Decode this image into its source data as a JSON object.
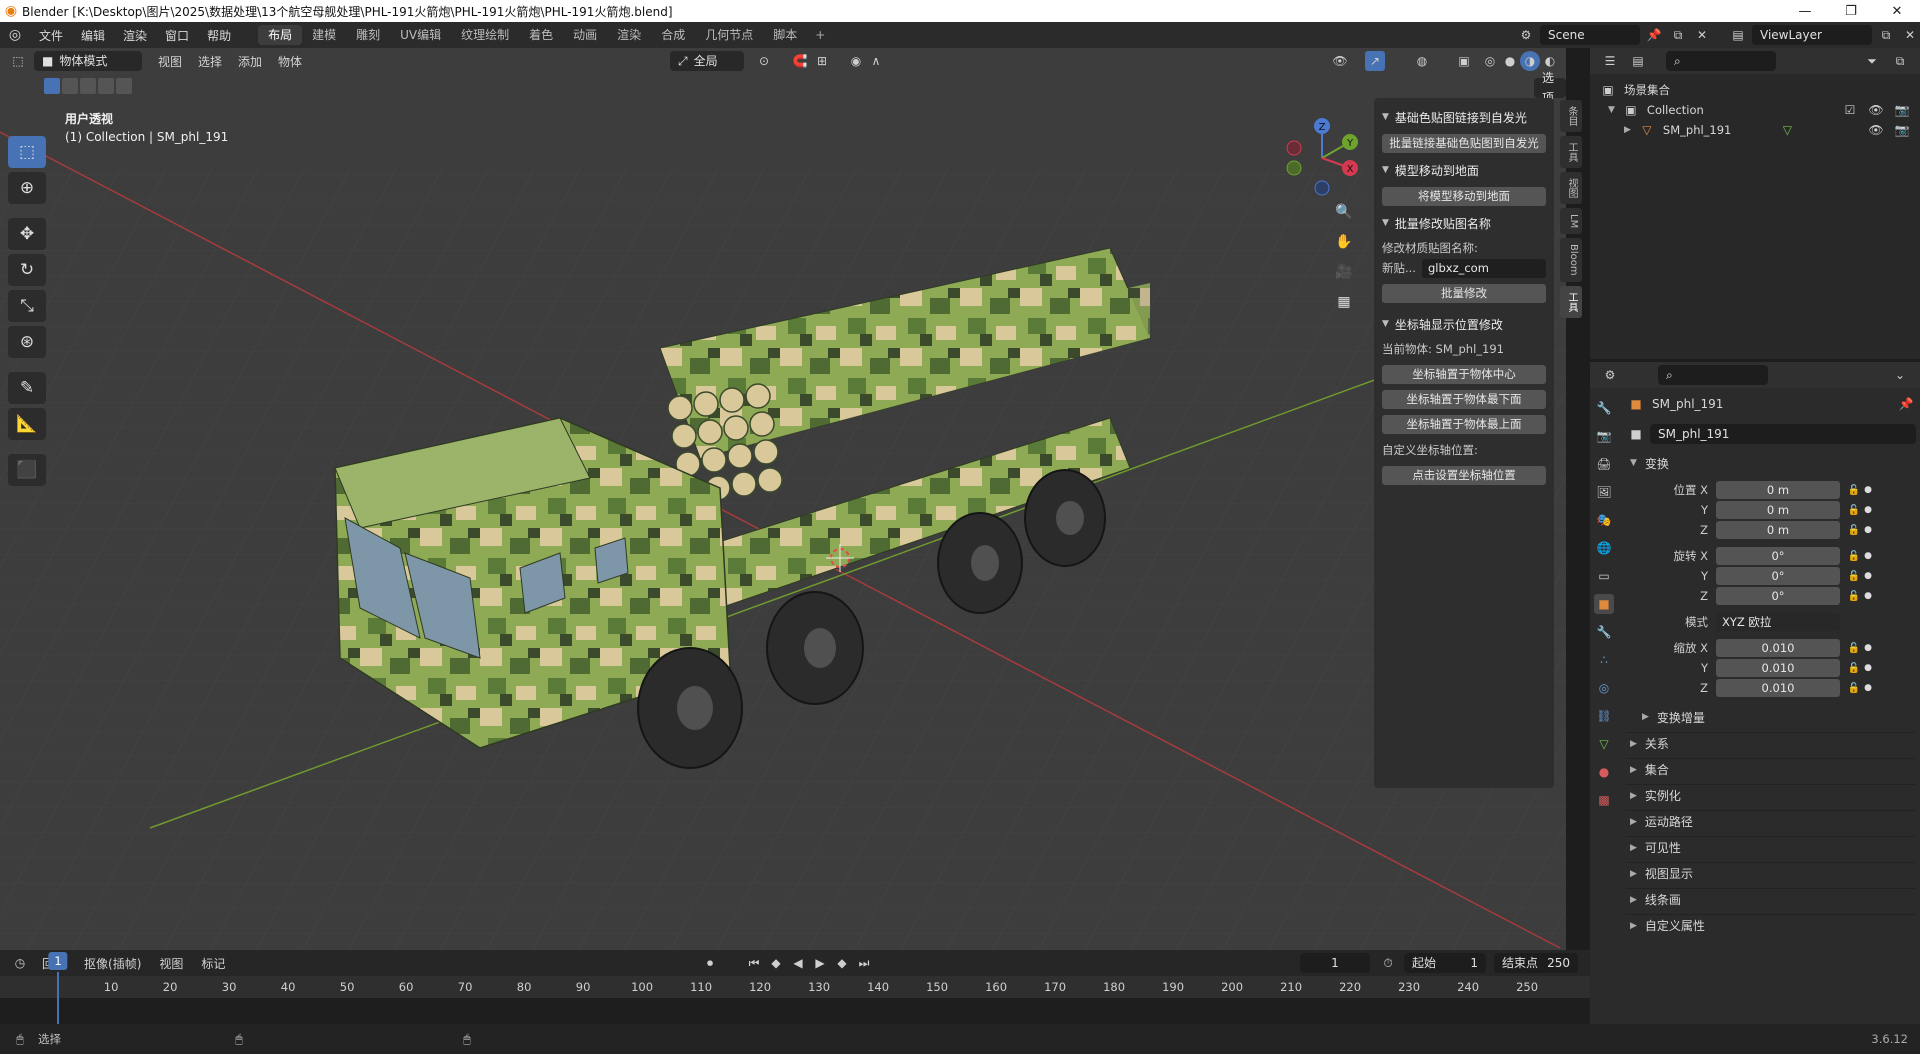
{
  "window": {
    "title": "Blender [K:\\Desktop\\图片\\2025\\数据处理\\13个航空母舰处理\\PHL-191火箭炮\\PHL-191火箭炮\\PHL-191火箭炮.blend]",
    "minimize": "—",
    "maximize": "❐",
    "close": "✕"
  },
  "menu": [
    "文件",
    "编辑",
    "渲染",
    "窗口",
    "帮助"
  ],
  "workspaces": [
    "布局",
    "建模",
    "雕刻",
    "UV编辑",
    "纹理绘制",
    "着色",
    "动画",
    "渲染",
    "合成",
    "几何节点",
    "脚本"
  ],
  "active_workspace": "布局",
  "scene": {
    "name": "Scene",
    "view_layer": "ViewLayer"
  },
  "viewport": {
    "mode": "物体模式",
    "menus": [
      "视图",
      "选择",
      "添加",
      "物体"
    ],
    "transform_orientation": "全局",
    "options": "选项",
    "view_name": "用户透视",
    "collection_info": "(1) Collection | SM_phl_191",
    "gizmo": {
      "z": "Z",
      "y": "Y",
      "x": "X"
    }
  },
  "side_tabs": [
    "条目",
    "工具",
    "视图",
    "LM",
    "Bloom",
    "工具"
  ],
  "npanel": {
    "panels": [
      {
        "title": "基础色贴图链接到自发光",
        "buttons": [
          "批量链接基础色贴图到自发光"
        ]
      },
      {
        "title": "模型移动到地面",
        "buttons": [
          "将模型移动到地面"
        ]
      },
      {
        "title": "批量修改贴图名称",
        "label": "修改材质贴图名称:",
        "field_label": "新贴...",
        "field_value": "glbxz_com",
        "buttons": [
          "批量修改"
        ]
      },
      {
        "title": "坐标轴显示位置修改",
        "label": "当前物体: SM_phl_191",
        "buttons": [
          "坐标轴置于物体中心",
          "坐标轴置于物体最下面",
          "坐标轴置于物体最上面"
        ],
        "label2": "自定义坐标轴位置:",
        "buttons2": [
          "点击设置坐标轴位置"
        ]
      }
    ]
  },
  "outliner": {
    "root": "场景集合",
    "collection": "Collection",
    "object": "SM_phl_191"
  },
  "properties": {
    "object_name": "SM_phl_191",
    "data_name": "SM_phl_191",
    "transform_header": "变换",
    "location": {
      "label_x": "位置 X",
      "x": "0 m",
      "y": "0 m",
      "z": "0 m"
    },
    "rotation": {
      "label_x": "旋转 X",
      "x": "0°",
      "y": "0°",
      "z": "0°"
    },
    "mode": {
      "label": "模式",
      "value": "XYZ 欧拉"
    },
    "scale": {
      "label_x": "缩放 X",
      "x": "0.010",
      "y": "0.010",
      "z": "0.010"
    },
    "axis_y": "Y",
    "axis_z": "Z",
    "delta": "变换增量",
    "sections": [
      "关系",
      "集合",
      "实例化",
      "运动路径",
      "可见性",
      "视图显示",
      "线条画",
      "自定义属性"
    ]
  },
  "timeline": {
    "menus": [
      "回放",
      "抠像(插帧)",
      "视图",
      "标记"
    ],
    "current_frame": "1",
    "start_label": "起始",
    "start": "1",
    "end_label": "结束点",
    "end": "250",
    "ticks": [
      "10",
      "20",
      "30",
      "40",
      "50",
      "60",
      "70",
      "80",
      "90",
      "100",
      "110",
      "120",
      "130",
      "140",
      "150",
      "160",
      "170",
      "180",
      "190",
      "200",
      "210",
      "220",
      "230",
      "240",
      "250"
    ]
  },
  "status": {
    "select": "选择",
    "version": "3.6.12"
  }
}
